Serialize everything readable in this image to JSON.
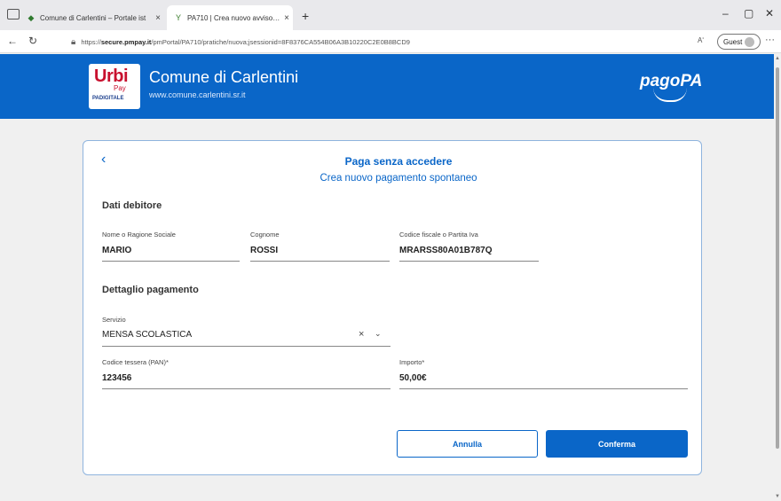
{
  "browser": {
    "tabs": [
      {
        "label": "Comune di Carlentini – Portale ist"
      },
      {
        "label": "PA710 | Crea nuovo avviso da pag"
      }
    ],
    "url_prefix": "https://",
    "url_host": "secure.pmpay.it",
    "url_path": "/pmPortal/PA710/pratiche/nuova;jsessionid=8F8376CA554B06A3B10220C2E0B8BCD9",
    "profile_label": "Guest",
    "read_aloud": "Aʹ"
  },
  "header": {
    "ente_name": "Comune di Carlentini",
    "ente_url": "www.comune.carlentini.sr.it",
    "logo_urbi": "Urbi",
    "logo_pay": "Pay",
    "logo_padigitale": "PADIGITALE",
    "pagopa": "pagoPA"
  },
  "form": {
    "title": "Paga senza accedere",
    "subtitle": "Crea nuovo pagamento spontaneo",
    "section_debtor": "Dati debitore",
    "name_label": "Nome o Ragione Sociale",
    "name_value": "MARIO",
    "surname_label": "Cognome",
    "surname_value": "ROSSI",
    "cf_label": "Codice fiscale o Partita Iva",
    "cf_value": "MRARSS80A01B787Q",
    "section_payment": "Dettaglio pagamento",
    "service_label": "Servizio",
    "service_value": "MENSA SCOLASTICA",
    "card_label": "Codice tessera (PAN)*",
    "card_value": "123456",
    "amount_label": "Importo*",
    "amount_value": "50,00€",
    "cancel_label": "Annulla",
    "confirm_label": "Conferma"
  },
  "colors": {
    "primary": "#0a66c8",
    "brand_red": "#c8102e"
  }
}
